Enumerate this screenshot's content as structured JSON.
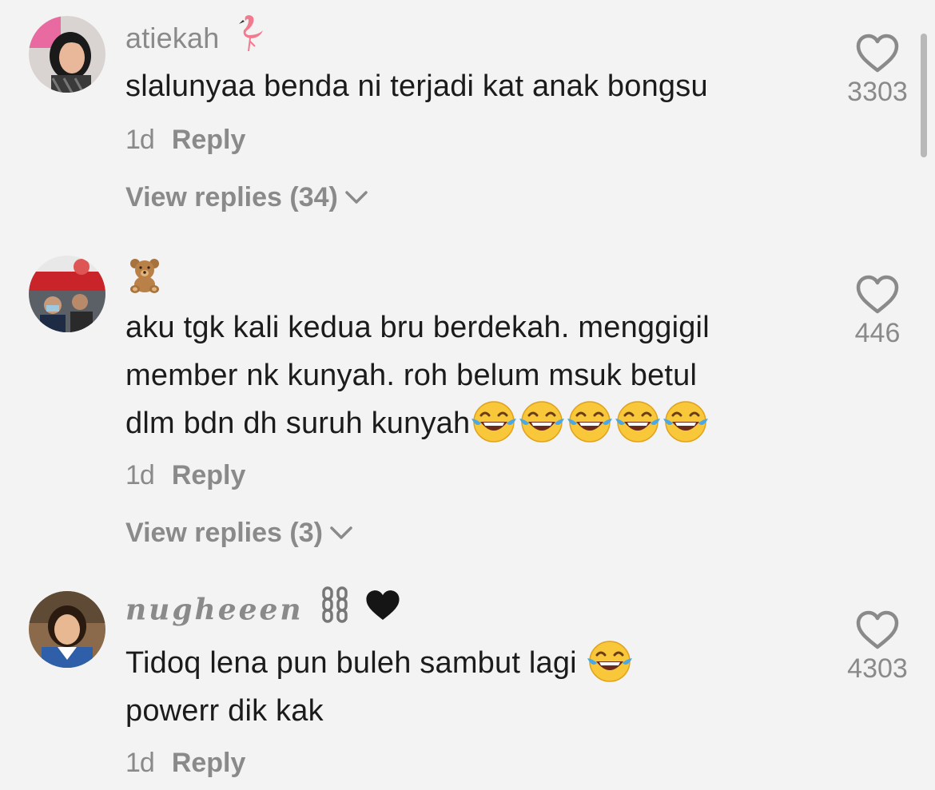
{
  "comments": [
    {
      "username": "atiekah",
      "username_emoji_icon": "flamingo-icon",
      "text": "slalunyaa benda ni terjadi kat anak bongsu",
      "time": "1d",
      "reply_label": "Reply",
      "view_replies": "View replies (34)",
      "likes": "3303"
    },
    {
      "username_emoji_icon": "teddy-bear-icon",
      "text_lines": [
        "aku tgk kali kedua bru berdekah. menggigil",
        "member nk kunyah. roh belum msuk betul",
        "dlm bdn dh suruh kunyah"
      ],
      "trailing_emoji_icon": "tears-of-joy-icon",
      "trailing_emoji_count": 5,
      "time": "1d",
      "reply_label": "Reply",
      "view_replies": "View replies (3)",
      "likes": "446"
    },
    {
      "username": "nugheeen",
      "username_emoji_icons": [
        "chains-icon",
        "black-heart-icon"
      ],
      "text_lines": [
        "Tidoq lena pun buleh sambut lagi",
        "powerr dik kak"
      ],
      "trailing_emoji_icon": "tears-of-joy-icon",
      "time": "1d",
      "reply_label": "Reply",
      "likes": "4303"
    }
  ],
  "colors": {
    "background": "#f3f3f3",
    "primary_text": "#1b1b1b",
    "secondary_text": "#8a8a8a"
  }
}
